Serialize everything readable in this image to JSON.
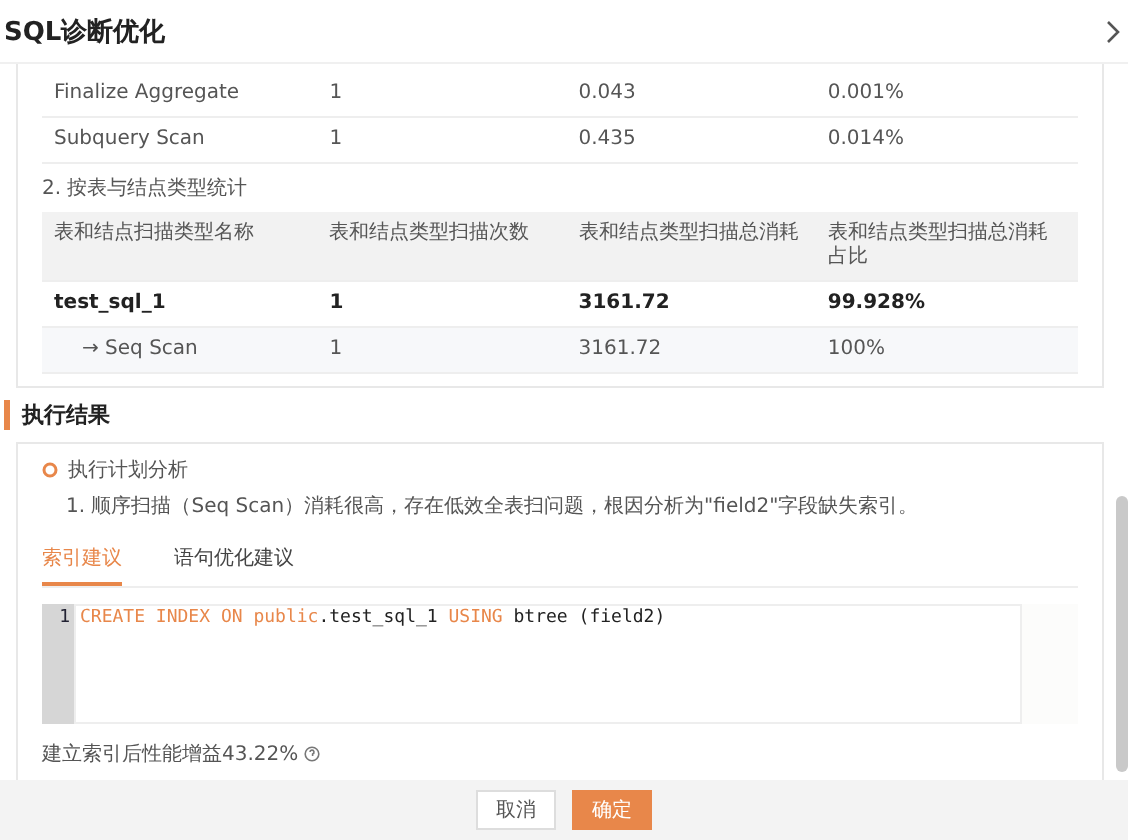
{
  "window": {
    "title": "SQL诊断优化"
  },
  "node_table": {
    "rows": [
      {
        "cells": [
          "Finalize Aggregate",
          "1",
          "0.043",
          "0.001%"
        ]
      },
      {
        "cells": [
          "Subquery Scan",
          "1",
          "0.435",
          "0.014%"
        ]
      }
    ]
  },
  "section_label": "2. 按表与结点类型统计",
  "type_table": {
    "columns": [
      "表和结点扫描类型名称",
      "表和结点类型扫描次数",
      "表和结点类型扫描总消耗",
      "表和结点类型扫描总消耗占比"
    ],
    "rows": [
      {
        "kind": "table",
        "cells": [
          "test_sql_1",
          "1",
          "3161.72",
          "99.928%"
        ]
      },
      {
        "kind": "node",
        "cells": [
          "→ Seq Scan",
          "1",
          "3161.72",
          "100%"
        ]
      }
    ]
  },
  "result": {
    "heading": "执行结果",
    "analysis": {
      "title": "执行计划分析",
      "text": "1. 顺序扫描（Seq Scan）消耗很高，存在低效全表扫问题，根因分析为\"field2\"字段缺失索引。"
    },
    "tabs": [
      {
        "label": "索引建议",
        "selected": true
      },
      {
        "label": "语句优化建议",
        "selected": false
      }
    ],
    "editor": {
      "lines": [
        {
          "number": "1",
          "tokens": [
            {
              "kind": "keyword",
              "text": "CREATE INDEX ON public"
            },
            {
              "kind": "plain",
              "text": ".test_sql_1 "
            },
            {
              "kind": "keyword",
              "text": "USING"
            },
            {
              "kind": "plain",
              "text": " btree (field2)"
            }
          ]
        }
      ]
    },
    "gain": "建立索引后性能增益43.22%"
  },
  "buttons": [
    {
      "label": "取消",
      "kind": "secondary"
    },
    {
      "label": "确定",
      "kind": "primary"
    }
  ]
}
